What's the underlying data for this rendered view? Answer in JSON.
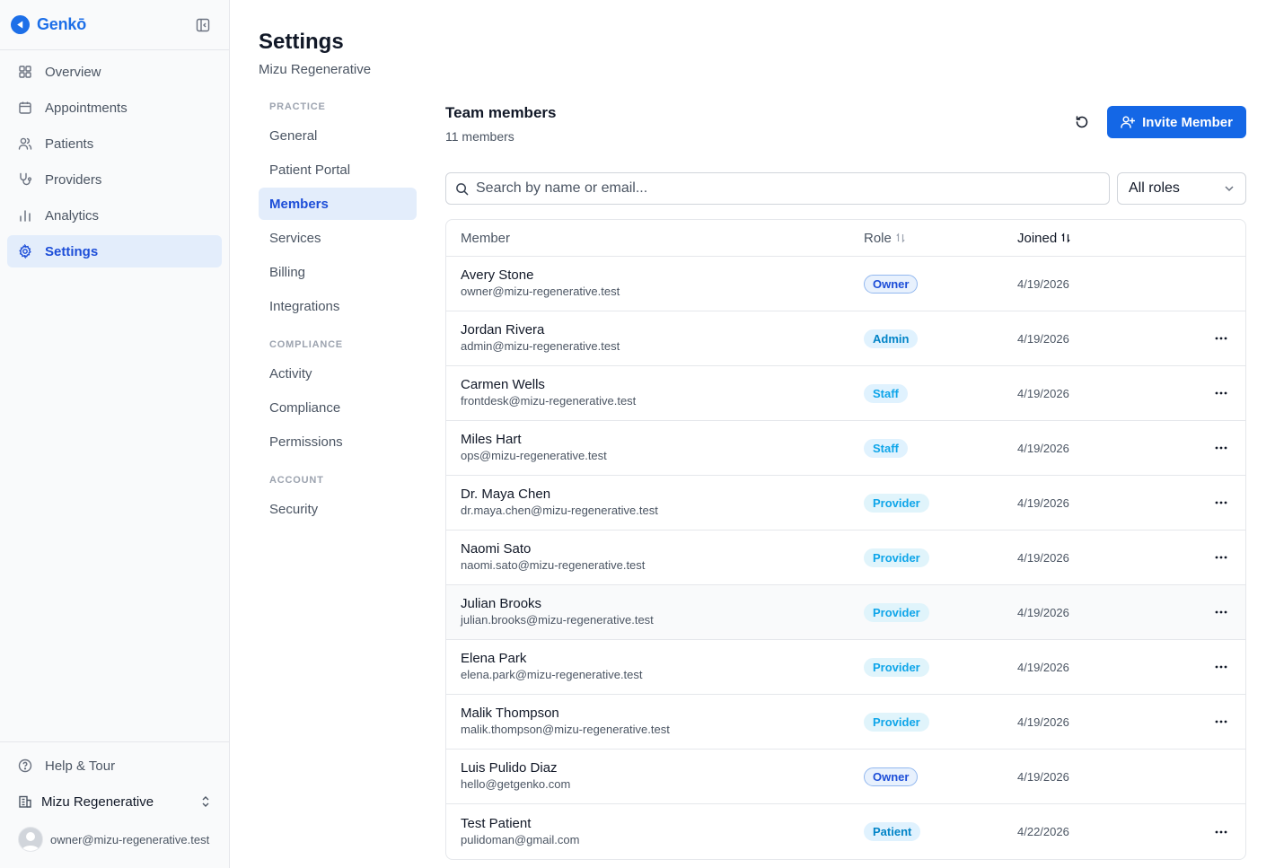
{
  "app": {
    "brand_name": "Genkō",
    "brand_color": "#1d6fe8"
  },
  "sidebar": {
    "items": [
      {
        "label": "Overview",
        "icon": "grid-icon"
      },
      {
        "label": "Appointments",
        "icon": "calendar-icon"
      },
      {
        "label": "Patients",
        "icon": "users-icon"
      },
      {
        "label": "Providers",
        "icon": "stethoscope-icon"
      },
      {
        "label": "Analytics",
        "icon": "bar-chart-icon"
      },
      {
        "label": "Settings",
        "icon": "gear-icon",
        "active": true
      }
    ],
    "help_label": "Help & Tour",
    "org_name": "Mizu Regenerative",
    "user_email": "owner@mizu-regenerative.test"
  },
  "page": {
    "title": "Settings",
    "subtitle": "Mizu Regenerative"
  },
  "subnav": {
    "sections": [
      {
        "label": "PRACTICE",
        "items": [
          "General",
          "Patient Portal",
          "Members",
          "Services",
          "Billing",
          "Integrations"
        ]
      },
      {
        "label": "COMPLIANCE",
        "items": [
          "Activity",
          "Compliance",
          "Permissions"
        ]
      },
      {
        "label": "ACCOUNT",
        "items": [
          "Security"
        ]
      }
    ],
    "active": "Members"
  },
  "team": {
    "title": "Team members",
    "count": "11 members",
    "invite_label": "Invite Member",
    "search_placeholder": "Search by name or email...",
    "role_filter": "All roles"
  },
  "table": {
    "columns": {
      "member": "Member",
      "role": "Role",
      "joined": "Joined"
    },
    "rows": [
      {
        "name": "Avery Stone",
        "email": "owner@mizu-regenerative.test",
        "role": "Owner",
        "joined": "4/19/2026",
        "actions": false
      },
      {
        "name": "Jordan Rivera",
        "email": "admin@mizu-regenerative.test",
        "role": "Admin",
        "joined": "4/19/2026",
        "actions": true
      },
      {
        "name": "Carmen Wells",
        "email": "frontdesk@mizu-regenerative.test",
        "role": "Staff",
        "joined": "4/19/2026",
        "actions": true
      },
      {
        "name": "Miles Hart",
        "email": "ops@mizu-regenerative.test",
        "role": "Staff",
        "joined": "4/19/2026",
        "actions": true
      },
      {
        "name": "Dr. Maya Chen",
        "email": "dr.maya.chen@mizu-regenerative.test",
        "role": "Provider",
        "joined": "4/19/2026",
        "actions": true
      },
      {
        "name": "Naomi Sato",
        "email": "naomi.sato@mizu-regenerative.test",
        "role": "Provider",
        "joined": "4/19/2026",
        "actions": true
      },
      {
        "name": "Julian Brooks",
        "email": "julian.brooks@mizu-regenerative.test",
        "role": "Provider",
        "joined": "4/19/2026",
        "actions": true,
        "hover": true
      },
      {
        "name": "Elena Park",
        "email": "elena.park@mizu-regenerative.test",
        "role": "Provider",
        "joined": "4/19/2026",
        "actions": true
      },
      {
        "name": "Malik Thompson",
        "email": "malik.thompson@mizu-regenerative.test",
        "role": "Provider",
        "joined": "4/19/2026",
        "actions": true
      },
      {
        "name": "Luis Pulido Diaz",
        "email": "hello@getgenko.com",
        "role": "Owner",
        "joined": "4/19/2026",
        "actions": false
      },
      {
        "name": "Test Patient",
        "email": "pulidoman@gmail.com",
        "role": "Patient",
        "joined": "4/22/2026",
        "actions": true
      }
    ]
  },
  "colors": {
    "primary": "#1467e6",
    "active_bg": "#e3edfb",
    "active_text": "#1d4ed8"
  }
}
